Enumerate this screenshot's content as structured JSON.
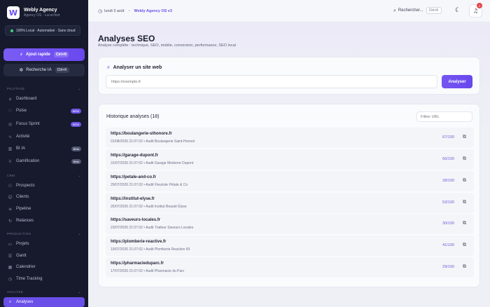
{
  "brand": {
    "name": "Webly Agency",
    "subtitle": "Agency OS · Local-first",
    "logo_letter": "W"
  },
  "local_badge": "100% Local · Automatisé · Sans cloud",
  "quick_add": {
    "label": "Ajout rapide",
    "shortcut": "Ctrl+N"
  },
  "ai_search": {
    "label": "Recherche IA",
    "shortcut": "Ctrl+K"
  },
  "sidebar": {
    "sections": [
      {
        "label": "PILOTAGE",
        "items": [
          {
            "label": "Dashboard",
            "icon": "home-icon"
          },
          {
            "label": "Pulse",
            "icon": "pulse-icon",
            "badge": "NEW"
          },
          {
            "label": "Focus Sprint",
            "icon": "target-icon",
            "badge": "NEW"
          },
          {
            "label": "Activité",
            "icon": "activity-icon"
          },
          {
            "label": "BI IA",
            "icon": "chart-icon",
            "badge": "Bêta"
          },
          {
            "label": "Gamification",
            "icon": "trophy-icon",
            "badge": "Bêta"
          }
        ]
      },
      {
        "label": "CRM",
        "items": [
          {
            "label": "Prospects",
            "icon": "users-icon"
          },
          {
            "label": "Clients",
            "icon": "user-icon"
          },
          {
            "label": "Pipeline",
            "icon": "pipeline-icon"
          },
          {
            "label": "Relances",
            "icon": "refresh-icon"
          }
        ]
      },
      {
        "label": "PRODUCTION",
        "items": [
          {
            "label": "Projets",
            "icon": "folder-icon"
          },
          {
            "label": "Gantt",
            "icon": "gantt-icon"
          },
          {
            "label": "Calendrier",
            "icon": "calendar-icon"
          },
          {
            "label": "Time Tracking",
            "icon": "clock-icon"
          }
        ]
      },
      {
        "label": "ANALYSE",
        "items": [
          {
            "label": "Analyses",
            "icon": "search-icon",
            "active": true
          }
        ]
      }
    ]
  },
  "topbar": {
    "date": "lundi 3 août",
    "version": "Webly Agency OS v3",
    "search_label": "Rechercher...",
    "search_shortcut": "Ctrl+K",
    "notification_count": "2"
  },
  "page": {
    "title": "Analyses SEO",
    "subtitle": "Analyse complète : technique, SEO, mobile, conversion, performance, SEO local"
  },
  "analyze": {
    "title": "Analyser un site web",
    "placeholder": "https://exemple.fr",
    "button": "Analyser"
  },
  "history": {
    "title": "Historique analyses (18)",
    "filter_placeholder": "Filtrer URL",
    "rows": [
      {
        "url": "https://boulangerie-sthonore.fr",
        "meta": "01/08/2026 21:07:02 • Audit Boulangerie Saint-Honoré",
        "score": "67/100"
      },
      {
        "url": "https://garage-dupont.fr",
        "meta": "31/07/2026 21:07:02 • Audit Garage Moderne Dupont",
        "score": "66/100"
      },
      {
        "url": "https://petale-and-co.fr",
        "meta": "29/07/2026 21:07:02 • Audit Fleuriste Pétale & Co",
        "score": "28/100"
      },
      {
        "url": "https://institut-elyse.fr",
        "meta": "26/07/2026 21:07:02 • Audit Institut Beauté Élyse",
        "score": "53/100"
      },
      {
        "url": "https://saveurs-locales.fr",
        "meta": "23/07/2026 21:07:02 • Audit Traiteur Saveurs Locales",
        "score": "30/100"
      },
      {
        "url": "https://plomberie-reactive.fr",
        "meta": "19/07/2026 21:07:02 • Audit Plomberie Reactive 69",
        "score": "41/100"
      },
      {
        "url": "https://pharmacieduparc.fr",
        "meta": "17/07/2026 21:07:02 • Audit Pharmacie du Parc",
        "score": "29/100"
      }
    ]
  }
}
